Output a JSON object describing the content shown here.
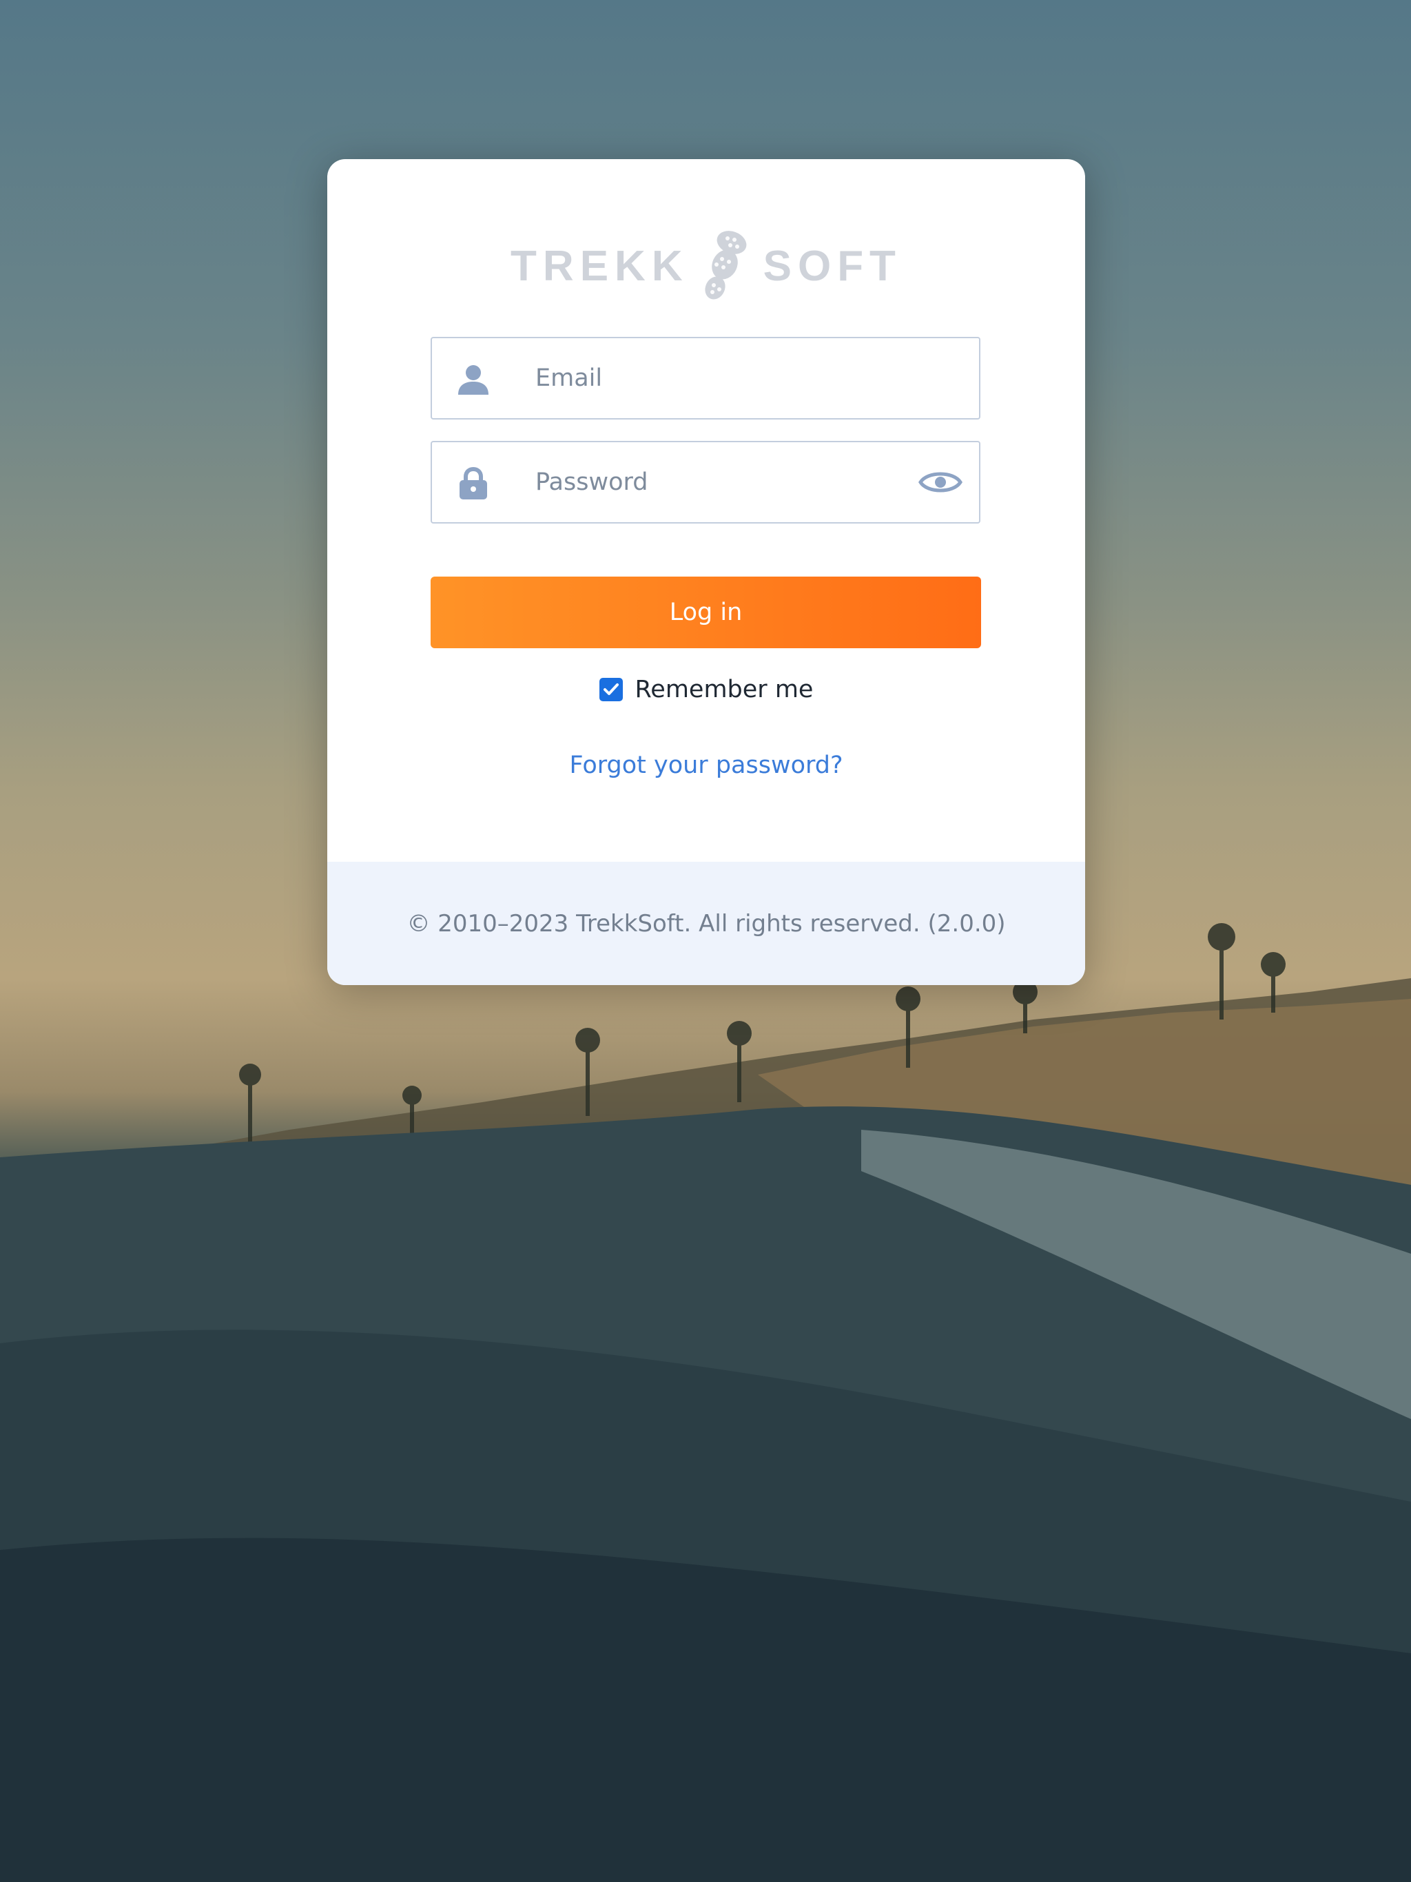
{
  "brand": {
    "logo_left": "TREKK",
    "logo_right": "SOFT"
  },
  "login_form": {
    "email_placeholder": "Email",
    "password_placeholder": "Password",
    "login_label": "Log in",
    "remember_label": "Remember me",
    "remember_checked": true,
    "forgot_label": "Forgot your password?"
  },
  "footer": {
    "copyright": "© 2010–2023 TrekkSoft. All rights reserved. (2.0.0)"
  },
  "icons": {
    "email": "user-icon",
    "password": "lock-icon",
    "reveal": "eye-icon",
    "logo": "footprint-icon"
  },
  "colors": {
    "accent_start": "#ff9327",
    "accent_end": "#ff6d16",
    "link": "#3b7cd9",
    "checkbox": "#1a6fe0",
    "footer_bg": "#eef3fc"
  }
}
